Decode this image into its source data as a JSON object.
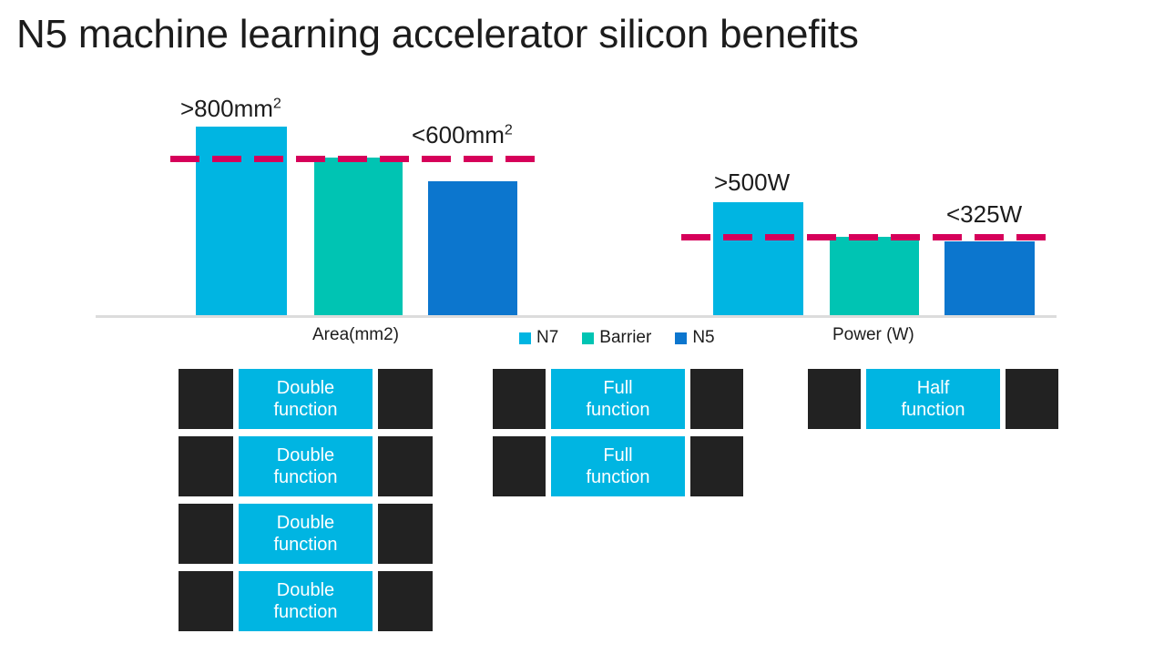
{
  "slide": {
    "title": "N5 machine learning accelerator silicon benefits",
    "background": "#ffffff"
  },
  "colors": {
    "n7": "#00b5e2",
    "barrier": "#00c4b3",
    "n5": "#0c76ce",
    "target_line": "#d6005a",
    "dark_block": "#222222",
    "axis": "#dcdcdc",
    "text": "#1c1c1c"
  },
  "chart_data": {
    "type": "bar",
    "title": "N5 machine learning accelerator silicon benefits",
    "grid": false,
    "legend_position": "bottom-center",
    "legend": [
      "N7",
      "Barrier",
      "N5"
    ],
    "panels": [
      {
        "name": "area",
        "xlabel": "Area(mm2)",
        "ylabel": "",
        "categories": [
          "N7",
          "Barrier",
          "N5"
        ],
        "series": [
          {
            "name": "Area(mm2)",
            "values": [
              800,
              660,
              570
            ]
          }
        ],
        "annotations": [
          {
            "text": ">800mm",
            "sup": "2",
            "target": "N7"
          },
          {
            "text": "<600mm",
            "sup": "2",
            "target": "threshold"
          }
        ],
        "threshold": {
          "label": "<600mm2",
          "value": 600
        },
        "ylim": [
          0,
          880
        ]
      },
      {
        "name": "power",
        "xlabel": "Power (W)",
        "ylabel": "",
        "categories": [
          "N7",
          "Barrier",
          "N5"
        ],
        "series": [
          {
            "name": "Power (W)",
            "values": [
              500,
              340,
              325
            ]
          }
        ],
        "annotations": [
          {
            "text": ">500W",
            "sup": "",
            "target": "N7"
          },
          {
            "text": "<325W",
            "sup": "",
            "target": "threshold"
          }
        ],
        "threshold": {
          "label": "<325W",
          "value": 330
        },
        "ylim": [
          0,
          560
        ]
      }
    ]
  },
  "chart": {
    "labels": {
      "area_high_prefix": ">800mm",
      "area_high_sup": "2",
      "area_target_prefix": "<600mm",
      "area_target_sup": "2",
      "power_high": ">500W",
      "power_target": "<325W",
      "axis_area": "Area(mm2)",
      "axis_power": "Power (W)"
    },
    "legend": [
      {
        "label": "N7",
        "color": "#00b5e2"
      },
      {
        "label": "Barrier",
        "color": "#00c4b3"
      },
      {
        "label": "N5",
        "color": "#0c76ce"
      }
    ]
  },
  "block_diagram": {
    "groups": [
      {
        "name": "double-function-group",
        "rows": [
          {
            "line1": "Double",
            "line2": "function"
          },
          {
            "line1": "Double",
            "line2": "function"
          },
          {
            "line1": "Double",
            "line2": "function"
          },
          {
            "line1": "Double",
            "line2": "function"
          }
        ]
      },
      {
        "name": "full-function-group",
        "rows": [
          {
            "line1": "Full",
            "line2": "function"
          },
          {
            "line1": "Full",
            "line2": "function"
          }
        ]
      },
      {
        "name": "half-function-group",
        "rows": [
          {
            "line1": "Half",
            "line2": "function"
          }
        ]
      }
    ]
  }
}
